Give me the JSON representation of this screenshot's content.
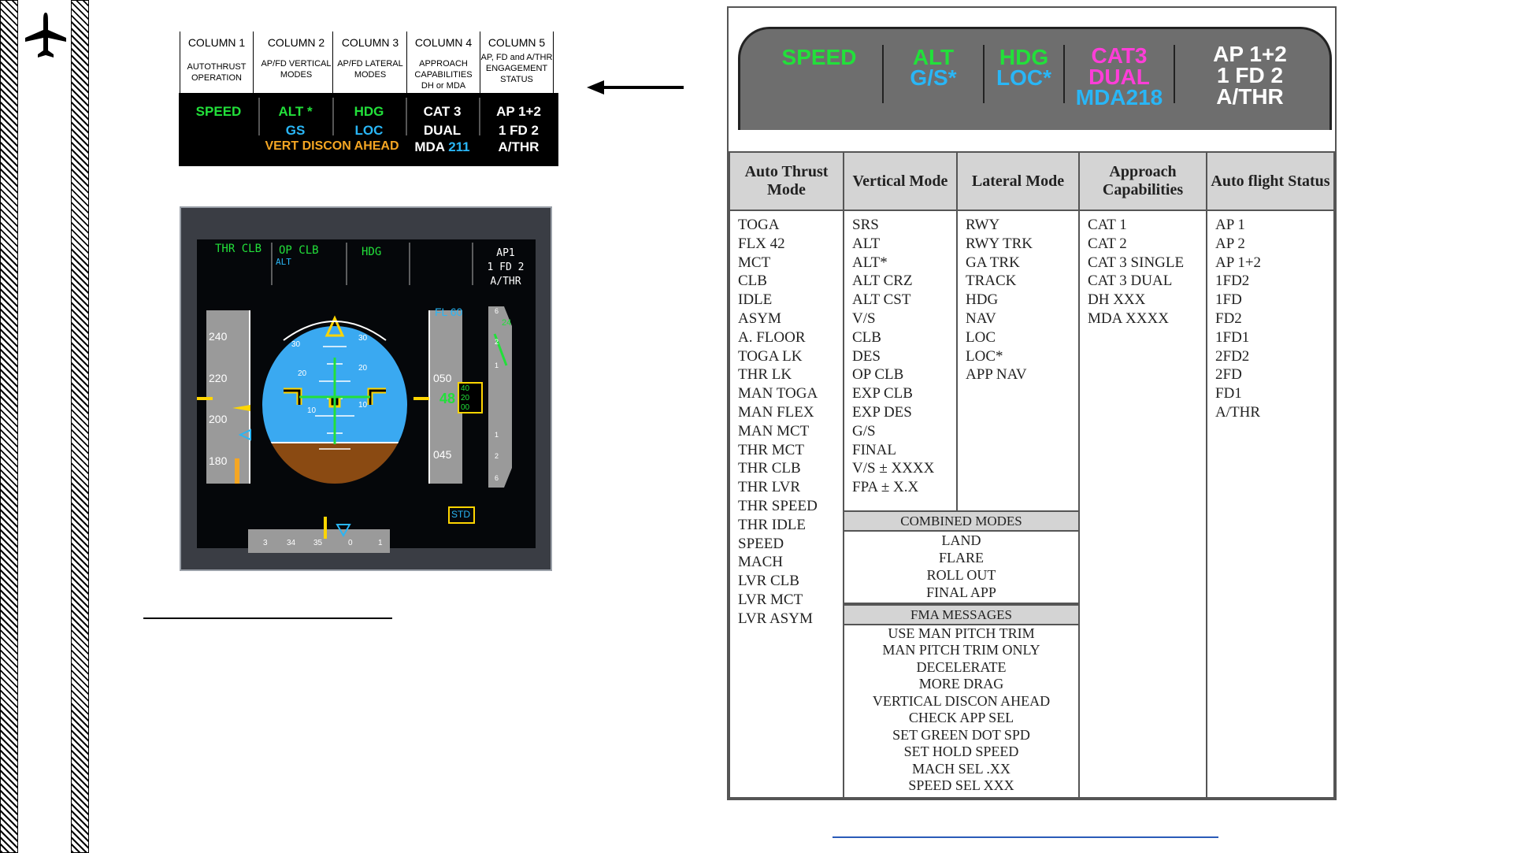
{
  "fma_legend": {
    "columns": [
      {
        "title": "COLUMN 1",
        "subtitle": "AUTOTHRUST OPERATION"
      },
      {
        "title": "COLUMN 2",
        "subtitle": "AP/FD VERTICAL MODES"
      },
      {
        "title": "COLUMN 3",
        "subtitle": "AP/FD LATERAL MODES"
      },
      {
        "title": "COLUMN 4",
        "subtitle": "APPROACH CAPABILITIES DH or MDA"
      },
      {
        "title": "COLUMN 5",
        "subtitle": "AP, FD and A/THR ENGAGEMENT STATUS"
      }
    ],
    "annunciations": {
      "speed": "SPEED",
      "alt": "ALT *",
      "gs": "GS",
      "hdg": "HDG",
      "loc": "LOC",
      "cat": "CAT 3",
      "dual": "DUAL",
      "mda_label": "MDA",
      "mda_value": "211",
      "ap": "AP 1+2",
      "fd": "1 FD 2",
      "athr": "A/THR",
      "message": "VERT DISCON AHEAD"
    },
    "colors": {
      "green": "#22e03a",
      "cyan": "#29b6f6",
      "amber": "#f5a623",
      "white": "#ffffff"
    }
  },
  "pfd": {
    "fma": {
      "c1": "THR CLB",
      "c2": "OP CLB",
      "c2_armed": "ALT",
      "c3": "HDG",
      "c5_line1": "AP1",
      "c5_line2": "1 FD 2",
      "c5_line3": "A/THR"
    },
    "speed_ticks": [
      "240",
      "220",
      "200",
      "180"
    ],
    "altitude_ticks": [
      "050",
      "045"
    ],
    "altitude_readout": "48",
    "altitude_drum": [
      "40",
      "20",
      "00"
    ],
    "fl_target": "FL 60",
    "baro": "STD",
    "pitch_ticks": [
      "30",
      "20",
      "10",
      "10",
      "20",
      "30",
      "20",
      "10",
      "10",
      "20",
      "30"
    ],
    "vsi_ticks": [
      "6",
      "2",
      "1",
      "1",
      "2",
      "6"
    ],
    "vsi_readout": "24",
    "heading_ticks": [
      "3",
      "34",
      "35",
      "0",
      "1"
    ]
  },
  "fma_display": {
    "speed": "SPEED",
    "alt": "ALT",
    "gs": "G/S*",
    "hdg": "HDG",
    "loc": "LOC*",
    "cat": "CAT3",
    "dual": "DUAL",
    "mda": "MDA218",
    "ap": "AP 1+2",
    "fd": "1 FD 2",
    "athr": "A/THR"
  },
  "mode_table": {
    "headers": [
      "Auto Thrust Mode",
      "Vertical Mode",
      "Lateral Mode",
      "Approach Capabilities",
      "Auto flight Status"
    ],
    "auto_thrust": [
      "TOGA",
      "FLX 42",
      "MCT",
      "CLB",
      "IDLE",
      "ASYM",
      "A.   FLOOR",
      "TOGA LK",
      "THR LK",
      "MAN TOGA",
      "MAN FLEX",
      "MAN MCT",
      "THR MCT",
      "THR CLB",
      "THR LVR",
      "THR SPEED",
      "THR IDLE",
      "SPEED",
      "MACH",
      "LVR CLB",
      "LVR MCT",
      "LVR ASYM"
    ],
    "vertical": [
      "SRS",
      "ALT",
      "ALT*",
      "ALT CRZ",
      "ALT CST",
      "V/S",
      "CLB",
      "DES",
      "OP CLB",
      "EXP CLB",
      "EXP DES",
      "G/S",
      "FINAL",
      "V/S ± XXXX",
      "FPA ± X.X"
    ],
    "lateral": [
      "RWY",
      "RWY TRK",
      "GA TRK",
      "TRACK",
      "HDG",
      "NAV",
      "LOC",
      "LOC*",
      "APP NAV"
    ],
    "approach": [
      "CAT 1",
      "CAT 2",
      "CAT 3 SINGLE",
      "CAT 3 DUAL",
      "DH XXX",
      "MDA XXXX"
    ],
    "status": [
      "AP 1",
      "AP 2",
      "AP 1+2",
      "1FD2",
      "1FD",
      "FD2",
      "1FD1",
      "2FD2",
      "2FD",
      "FD1",
      "A/THR"
    ],
    "combined_title": "COMBINED MODES",
    "combined": [
      "LAND",
      "FLARE",
      "ROLL OUT",
      "FINAL APP"
    ],
    "messages_title": "FMA MESSAGES",
    "messages": [
      "USE MAN PITCH TRIM",
      "MAN PITCH TRIM ONLY",
      "DECELERATE",
      "MORE DRAG",
      "VERTICAL DISCON AHEAD",
      "CHECK APP SEL",
      "SET GREEN DOT SPD",
      "SET HOLD SPEED",
      "MACH SEL .XX",
      "SPEED SEL XXX"
    ]
  }
}
